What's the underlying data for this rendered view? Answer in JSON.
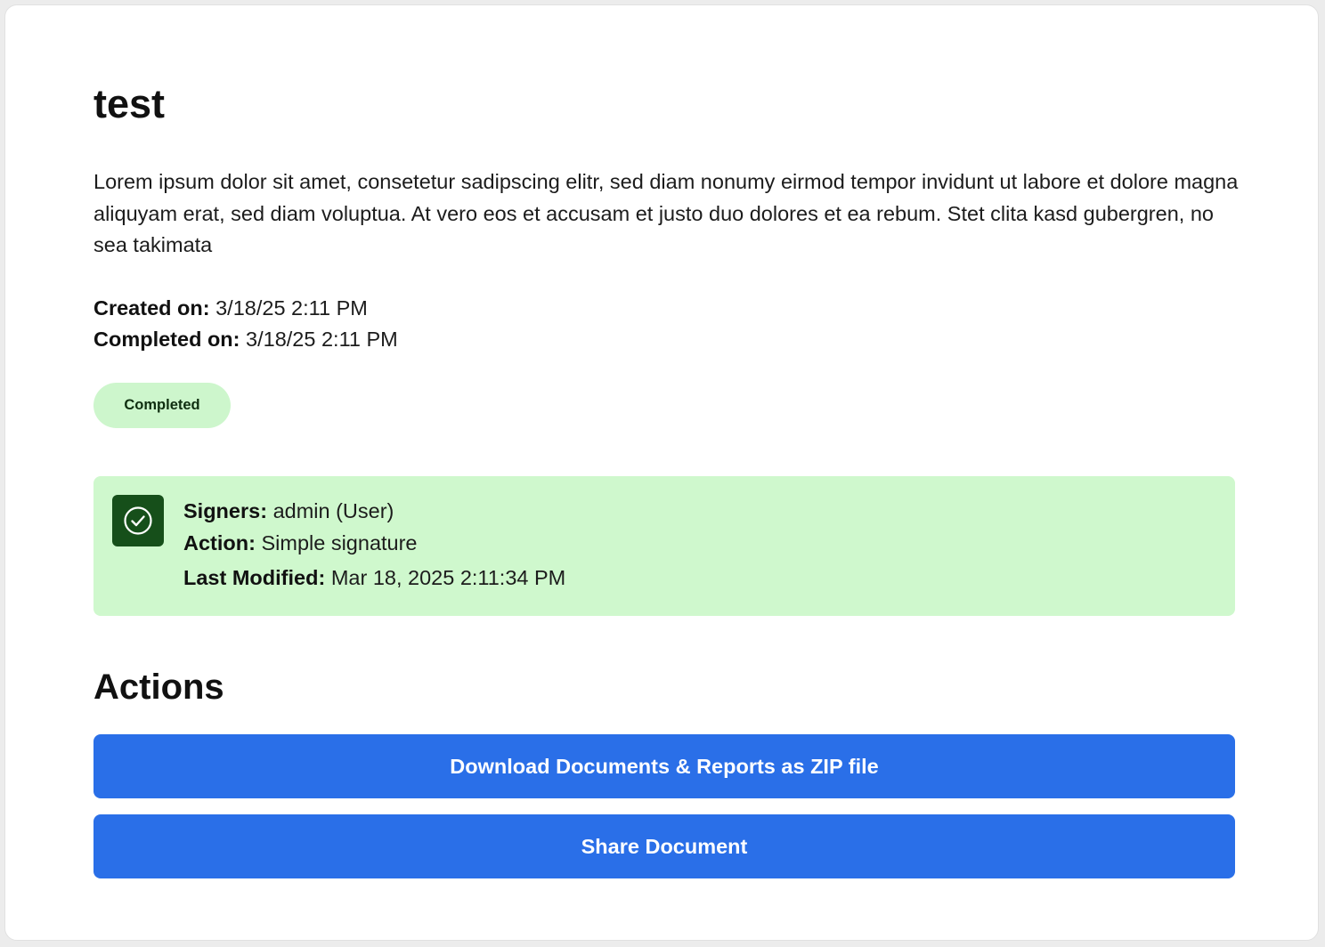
{
  "document": {
    "title": "test",
    "description": "Lorem ipsum dolor sit amet, consetetur sadipscing elitr, sed diam nonumy eirmod tempor invidunt ut labore et dolore magna aliquyam erat, sed diam voluptua. At vero eos et accusam et justo duo dolores et ea rebum. Stet clita kasd gubergren, no sea takimata",
    "created_label": "Created on:",
    "created_value": "3/18/25 2:11 PM",
    "completed_label": "Completed on:",
    "completed_value": "3/18/25 2:11 PM",
    "status": "Completed"
  },
  "signer": {
    "icon": "check-circle-icon",
    "signers_label": "Signers:",
    "signers_value": "admin (User)",
    "action_label": "Action:",
    "action_value": "Simple signature",
    "modified_label": "Last Modified:",
    "modified_value": "Mar 18, 2025 2:11:34 PM"
  },
  "actions": {
    "heading": "Actions",
    "download_label": "Download Documents & Reports as ZIP file",
    "share_label": "Share Document"
  },
  "colors": {
    "status_badge_bg": "#cdf6cc",
    "signer_box_bg": "#cff8cd",
    "signer_icon_bg": "#164f1a",
    "primary_button": "#2a6fe8"
  }
}
